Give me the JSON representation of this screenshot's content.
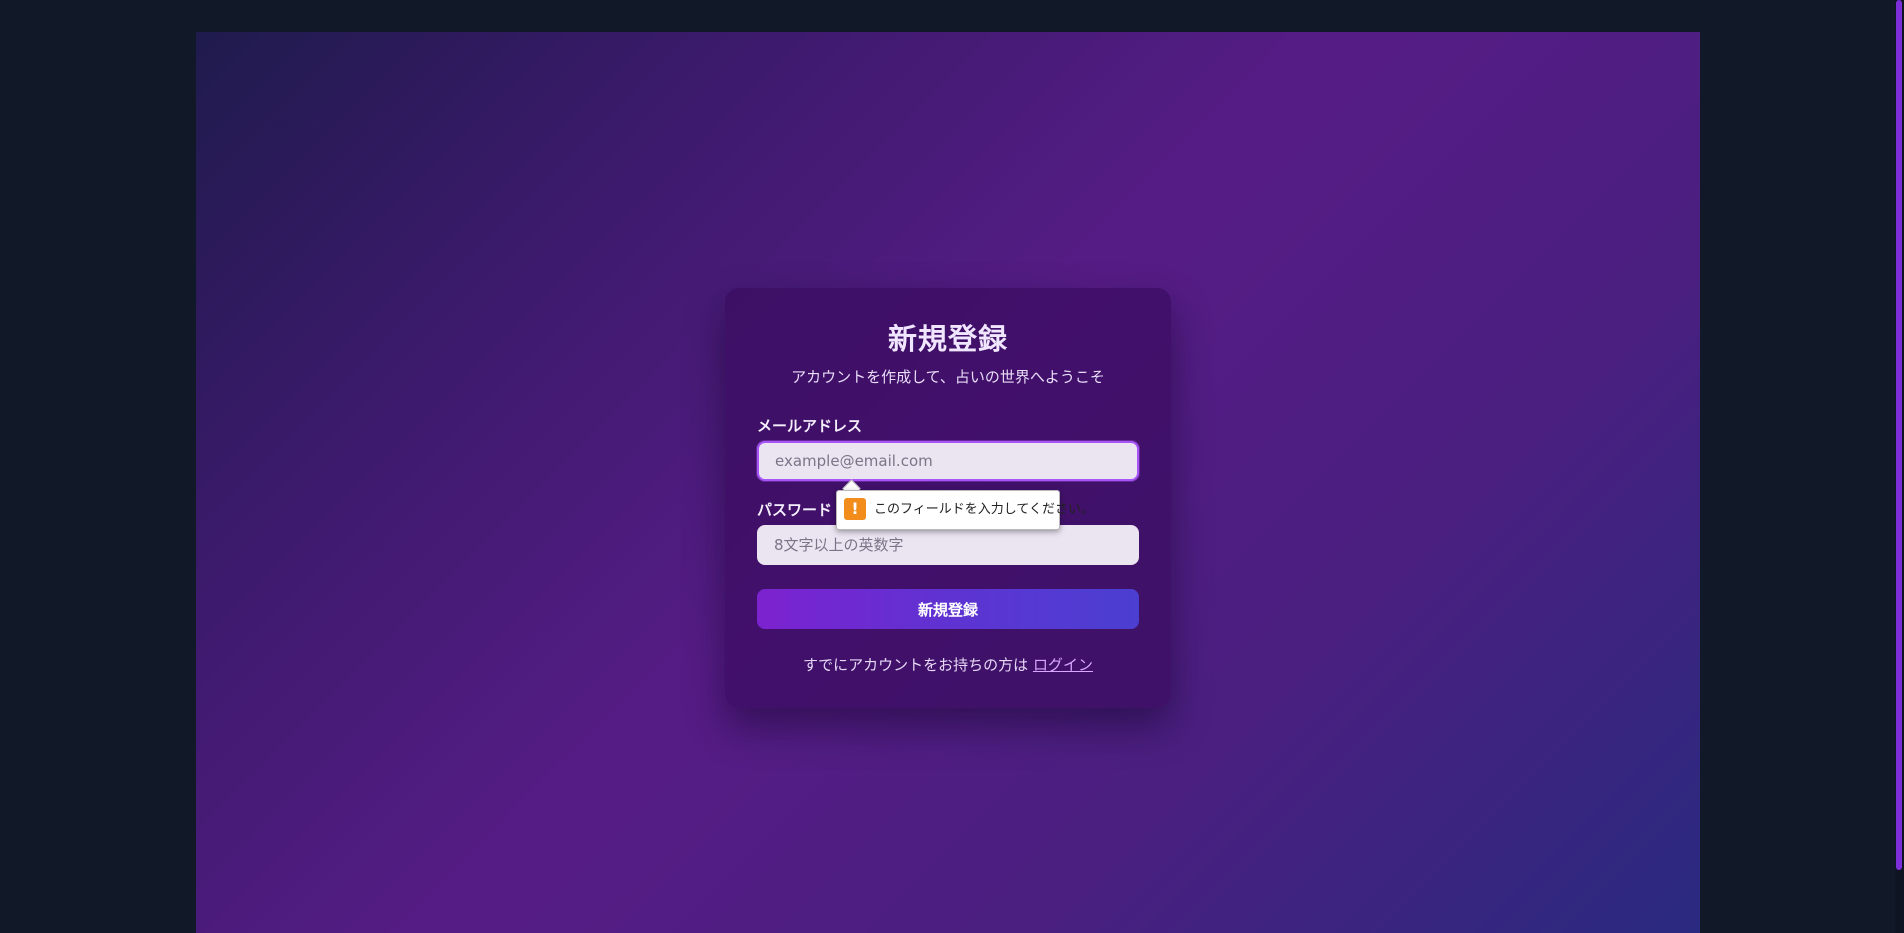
{
  "form": {
    "title": "新規登録",
    "subtitle": "アカウントを作成して、占いの世界へようこそ",
    "email_label": "メールアドレス",
    "email_placeholder": "example@email.com",
    "password_label": "パスワード",
    "password_placeholder": "8文字以上の英数字",
    "submit_label": "新規登録",
    "footer_text": "すでにアカウントをお持ちの方は ",
    "login_link": "ログイン"
  },
  "validation": {
    "message": "このフィールドを入力してください。",
    "icon": "warning-icon",
    "icon_glyph": "!"
  },
  "colors": {
    "accent": "#a855f7",
    "button_start": "#7c22cf",
    "button_end": "#4b3fd1",
    "warning": "#f28c1a"
  }
}
